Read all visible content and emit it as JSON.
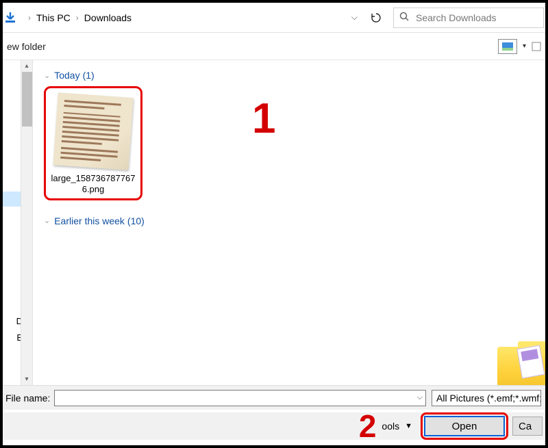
{
  "breadcrumb": {
    "item0": "This PC",
    "item1": "Downloads"
  },
  "search": {
    "placeholder": "Search Downloads"
  },
  "toolbar": {
    "new_folder": "ew folder"
  },
  "nav": {
    "drive_d": "D:)",
    "drive_e": "E:)"
  },
  "groups": {
    "today": {
      "label": "Today",
      "count": "(1)"
    },
    "earlier": {
      "label": "Earlier this week",
      "count": "(10)"
    }
  },
  "file": {
    "name": "large_1587367877676.png"
  },
  "annotations": {
    "one": "1",
    "two": "2"
  },
  "fn": {
    "label": "File name:"
  },
  "filter": {
    "text": "All Pictures (*.emf;*.wmf;*."
  },
  "tools": {
    "label": "ools"
  },
  "buttons": {
    "open": "Open",
    "cancel": "Ca"
  }
}
